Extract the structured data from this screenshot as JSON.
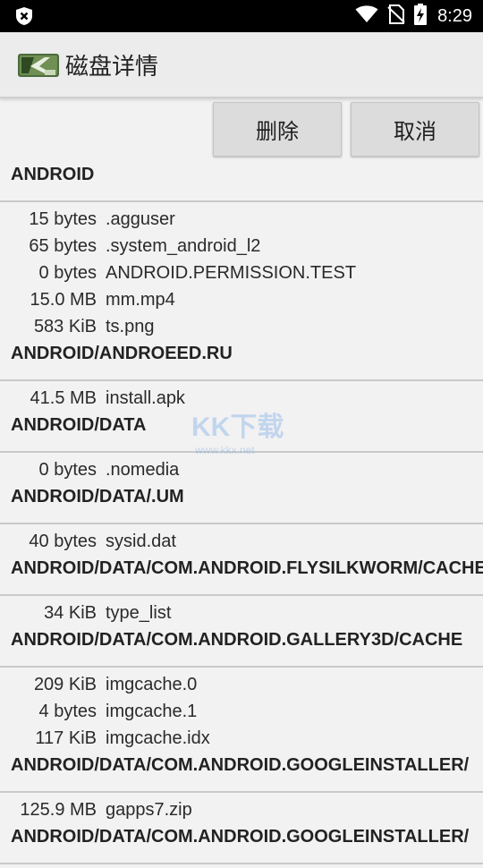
{
  "status_bar": {
    "time": "8:29",
    "icons": [
      "shield-x-icon",
      "wifi-icon",
      "no-sim-icon",
      "battery-charging-icon"
    ]
  },
  "app_bar": {
    "title": "磁盘详情",
    "logo_icon": "app-logo-icon"
  },
  "buttons": {
    "delete": "删除",
    "cancel": "取消"
  },
  "groups": [
    {
      "dir": "ANDROID",
      "files": [
        {
          "size": "15 bytes",
          "name": ".agguser"
        },
        {
          "size": "65 bytes",
          "name": ".system_android_l2"
        },
        {
          "size": "0 bytes",
          "name": "ANDROID.PERMISSION.TEST"
        },
        {
          "size": "15.0 MB",
          "name": "mm.mp4"
        },
        {
          "size": "583 KiB",
          "name": "ts.png"
        }
      ]
    },
    {
      "dir": "ANDROID/ANDROEED.RU",
      "files": [
        {
          "size": "41.5 MB",
          "name": "install.apk"
        }
      ]
    },
    {
      "dir": "ANDROID/DATA",
      "files": [
        {
          "size": "0 bytes",
          "name": ".nomedia"
        }
      ]
    },
    {
      "dir": "ANDROID/DATA/.UM",
      "files": [
        {
          "size": "40 bytes",
          "name": "sysid.dat"
        }
      ]
    },
    {
      "dir": "ANDROID/DATA/COM.ANDROID.FLYSILKWORM/CACHE",
      "files": [
        {
          "size": "34 KiB",
          "name": "type_list"
        }
      ]
    },
    {
      "dir": "ANDROID/DATA/COM.ANDROID.GALLERY3D/CACHE",
      "files": [
        {
          "size": "209 KiB",
          "name": "imgcache.0"
        },
        {
          "size": "4 bytes",
          "name": "imgcache.1"
        },
        {
          "size": "117 KiB",
          "name": "imgcache.idx"
        }
      ]
    },
    {
      "dir": "ANDROID/DATA/COM.ANDROID.GOOGLEINSTALLER/",
      "files": [
        {
          "size": "125.9 MB",
          "name": "gapps7.zip"
        }
      ]
    },
    {
      "dir": "ANDROID/DATA/COM.ANDROID.GOOGLEINSTALLER/",
      "files": []
    }
  ],
  "watermark": {
    "text": "KK下载",
    "url": "www.kkx.net"
  }
}
